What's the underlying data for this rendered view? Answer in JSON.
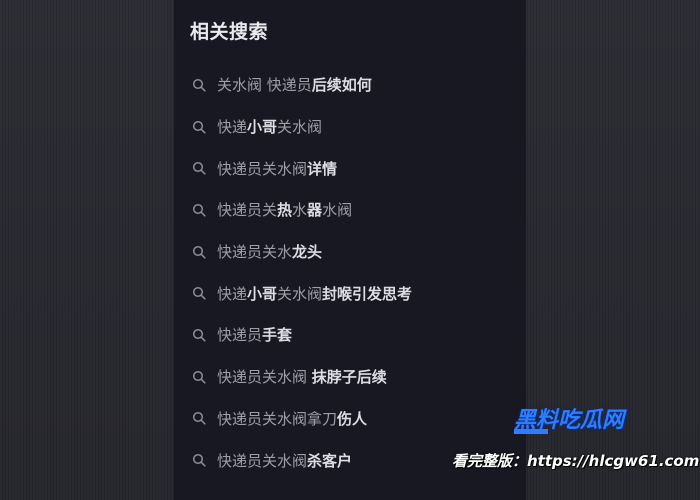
{
  "panel": {
    "title": "相关搜索",
    "items": [
      {
        "dim": "关水阀 快递员",
        "hi": "后续如何"
      },
      {
        "dim": "快递",
        "hi": "小哥",
        "dim2": "关水阀"
      },
      {
        "dim": "快递员关水阀",
        "hi": "详情"
      },
      {
        "dim": "快递员关",
        "hi": "热",
        "dim2": "水",
        "hi2": "器",
        "dim3": "水阀"
      },
      {
        "dim": "快递员关水",
        "hi": "龙头"
      },
      {
        "dim": "快递",
        "hi": "小哥",
        "dim2": "关水阀",
        "hi2": "封喉引发思考"
      },
      {
        "dim": "快递员",
        "hi": "手套"
      },
      {
        "dim": "快递员关水阀 ",
        "hi": "抹脖子后续"
      },
      {
        "dim": "快递员关水阀拿刀",
        "hi": "伤人"
      },
      {
        "dim": "快递员关水阀",
        "hi": "杀客户"
      }
    ]
  },
  "watermark": {
    "logo_part1": "黑料",
    "logo_part2": "吃瓜网",
    "url_text": "看完整版：https://hlcgw61.com",
    "accent_color": "#2f7dff"
  },
  "icons": {
    "search": "search-icon"
  }
}
